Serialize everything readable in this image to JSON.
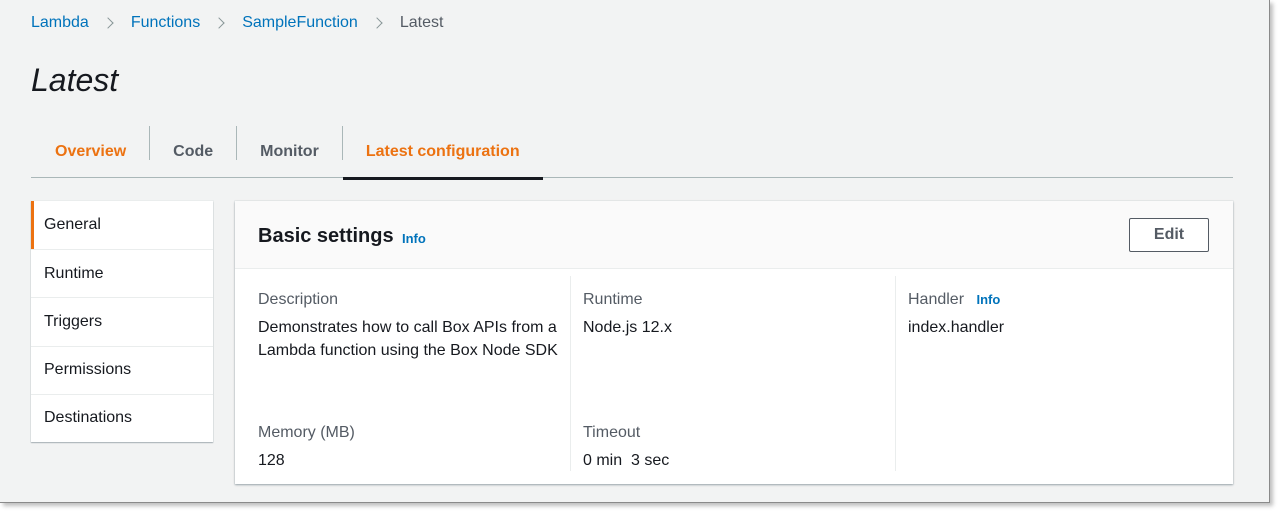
{
  "breadcrumb": {
    "items": [
      "Lambda",
      "Functions",
      "SampleFunction"
    ],
    "current": "Latest"
  },
  "page": {
    "title": "Latest"
  },
  "tabs": [
    {
      "label": "Overview"
    },
    {
      "label": "Code"
    },
    {
      "label": "Monitor"
    },
    {
      "label": "Latest configuration"
    }
  ],
  "sidenav": {
    "items": [
      "General",
      "Runtime",
      "Triggers",
      "Permissions",
      "Destinations"
    ]
  },
  "panel": {
    "title": "Basic settings",
    "info": "Info",
    "edit_label": "Edit",
    "description": {
      "label": "Description",
      "value": "Demonstrates how to call Box APIs from a Lambda function using the Box Node SDK"
    },
    "runtime": {
      "label": "Runtime",
      "value": "Node.js 12.x"
    },
    "handler": {
      "label": "Handler",
      "info": "Info",
      "value": "index.handler"
    },
    "memory": {
      "label": "Memory (MB)",
      "value": "128"
    },
    "timeout": {
      "label": "Timeout",
      "value": "0 min  3 sec"
    }
  },
  "colors": {
    "accent": "#ec7211",
    "link": "#0073bb",
    "background": "#f2f3f3"
  }
}
